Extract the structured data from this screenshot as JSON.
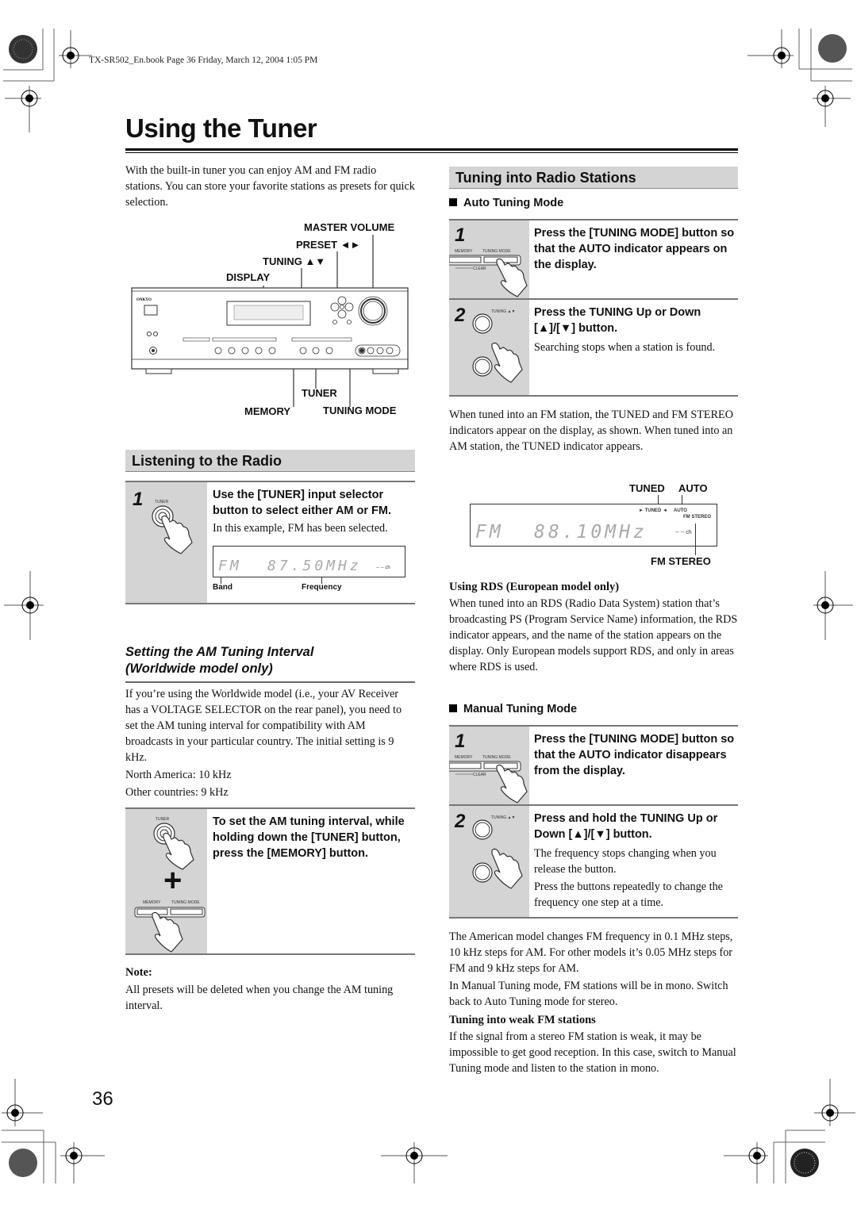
{
  "print_header": "TX-SR502_En.book  Page 36  Friday, March 12, 2004  1:05 PM",
  "page_title": "Using the Tuner",
  "intro": "With the built-in tuner you can enjoy AM and FM radio stations. You can store your favorite stations as presets for quick selection.",
  "receiver_diagram": {
    "brand": "ONKYO",
    "labels": {
      "master_volume": "MASTER VOLUME",
      "preset": "PRESET ◄►",
      "tuning": "TUNING ▲▼",
      "display": "DISPLAY",
      "tuner": "TUNER",
      "memory": "MEMORY",
      "tuning_mode": "TUNING MODE"
    }
  },
  "listening": {
    "heading": "Listening to the Radio",
    "step1": {
      "number": "1",
      "icon_label": "TUNER",
      "instruction": "Use the [TUNER] input selector button to select either AM or FM.",
      "description": "In this example, FM has been selected.",
      "display": {
        "band": "FM",
        "frequency": "87.50MHz",
        "channel": "-- -- ch"
      },
      "band_label": "Band",
      "frequency_label": "Frequency"
    }
  },
  "am_interval": {
    "heading_line1": "Setting the AM Tuning Interval",
    "heading_line2": "(Worldwide model only)",
    "body": "If you’re using the Worldwide model (i.e., your AV Receiver has a VOLTAGE SELECTOR on the rear panel), you need to set the AM tuning interval for compatibility with AM broadcasts in your particular country. The initial setting is 9 kHz.",
    "north_america": "North America: 10 kHz",
    "other": "Other countries: 9 kHz",
    "step": {
      "icon_tuner": "TUNER",
      "icon_memory": "MEMORY",
      "icon_tuning_mode": "TUNING MODE",
      "plus": "+",
      "instruction": "To set the AM tuning interval, while holding down the [TUNER] button, press the [MEMORY] button."
    },
    "note_title": "Note:",
    "note_body": "All presets will be deleted when you change the AM tuning interval."
  },
  "tuning": {
    "heading": "Tuning into Radio Stations",
    "auto": {
      "subheading": "Auto Tuning Mode",
      "step1": {
        "number": "1",
        "icon_memory": "MEMORY",
        "icon_tuning_mode": "TUNING MODE",
        "icon_clear": "CLEAR",
        "instruction": "Press the [TUNING MODE] button so that the AUTO indicator appears on the display."
      },
      "step2": {
        "number": "2",
        "icon_label": "TUNING ▲▼",
        "instruction": "Press the TUNING Up or Down [▲]/[▼] button.",
        "description": "Searching stops when a station is found."
      },
      "after_text": "When tuned into an FM station, the TUNED and FM STEREO indicators appear on the display, as shown. When tuned into an AM station, the TUNED indicator appears.",
      "display": {
        "tuned_label": "TUNED",
        "auto_label": "AUTO",
        "tuned_ind": "► TUNED ◄",
        "auto_ind": "AUTO",
        "fmstereo_ind": "FM STEREO",
        "band": "FM",
        "frequency": "88.10MHz",
        "channel": "-- -- ch",
        "fmstereo_label": "FM STEREO"
      }
    },
    "rds": {
      "heading": "Using RDS (European model only)",
      "body": "When tuned into an RDS (Radio Data System) station that’s broadcasting PS (Program Service Name) information, the RDS indicator appears, and the name of the station appears on the display. Only European models support RDS, and only in areas where RDS is used."
    },
    "manual": {
      "subheading": "Manual Tuning Mode",
      "step1": {
        "number": "1",
        "icon_memory": "MEMORY",
        "icon_tuning_mode": "TUNING MODE",
        "icon_clear": "CLEAR",
        "instruction": "Press the [TUNING MODE] button so that the AUTO indicator disappears from the display."
      },
      "step2": {
        "number": "2",
        "icon_label": "TUNING ▲▼",
        "instruction": "Press and hold the TUNING Up or Down [▲]/[▼] button.",
        "desc1": "The frequency stops changing when you release the button.",
        "desc2": "Press the buttons repeatedly to change the frequency one step at a time."
      }
    },
    "steps_text1": "The American model changes FM frequency in 0.1 MHz steps, 10 kHz steps for AM. For other models it’s 0.05 MHz steps for FM and 9 kHz steps for AM.",
    "steps_text2": "In Manual Tuning mode, FM stations will be in mono. Switch back to Auto Tuning mode for stereo.",
    "weak": {
      "heading": "Tuning into weak FM stations",
      "body": "If the signal from a stereo FM station is weak, it may be impossible to get good reception. In this case, switch to Manual Tuning mode and listen to the station in mono."
    }
  },
  "page_number": "36"
}
